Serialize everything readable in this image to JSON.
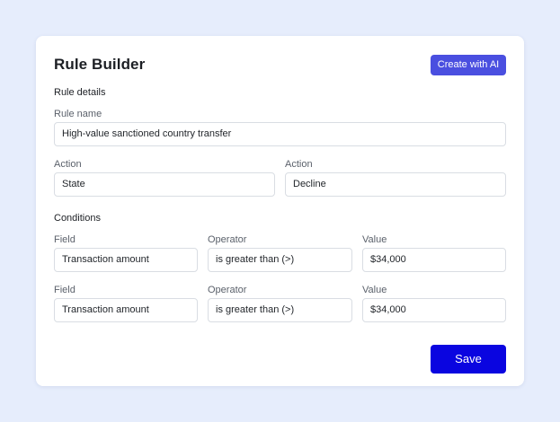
{
  "header": {
    "title": "Rule Builder",
    "ai_button_label": "Create with AI"
  },
  "rule_details": {
    "heading": "Rule details",
    "rule_name_label": "Rule name",
    "rule_name_value": "High-value sanctioned country transfer",
    "actions": [
      {
        "label": "Action",
        "value": "State"
      },
      {
        "label": "Action",
        "value": "Decline"
      }
    ]
  },
  "conditions": {
    "heading": "Conditions",
    "rows": [
      {
        "field_label": "Field",
        "field_value": "Transaction amount",
        "operator_label": "Operator",
        "operator_value": "is greater than (>)",
        "value_label": "Value",
        "value_value": "$34,000"
      },
      {
        "field_label": "Field",
        "field_value": "Transaction amount",
        "operator_label": "Operator",
        "operator_value": "is greater than (>)",
        "value_label": "Value",
        "value_value": "$34,000"
      }
    ]
  },
  "footer": {
    "save_label": "Save"
  },
  "colors": {
    "background": "#e6edfc",
    "ai_button": "#4a4fe0",
    "save_button": "#0a05e0"
  }
}
